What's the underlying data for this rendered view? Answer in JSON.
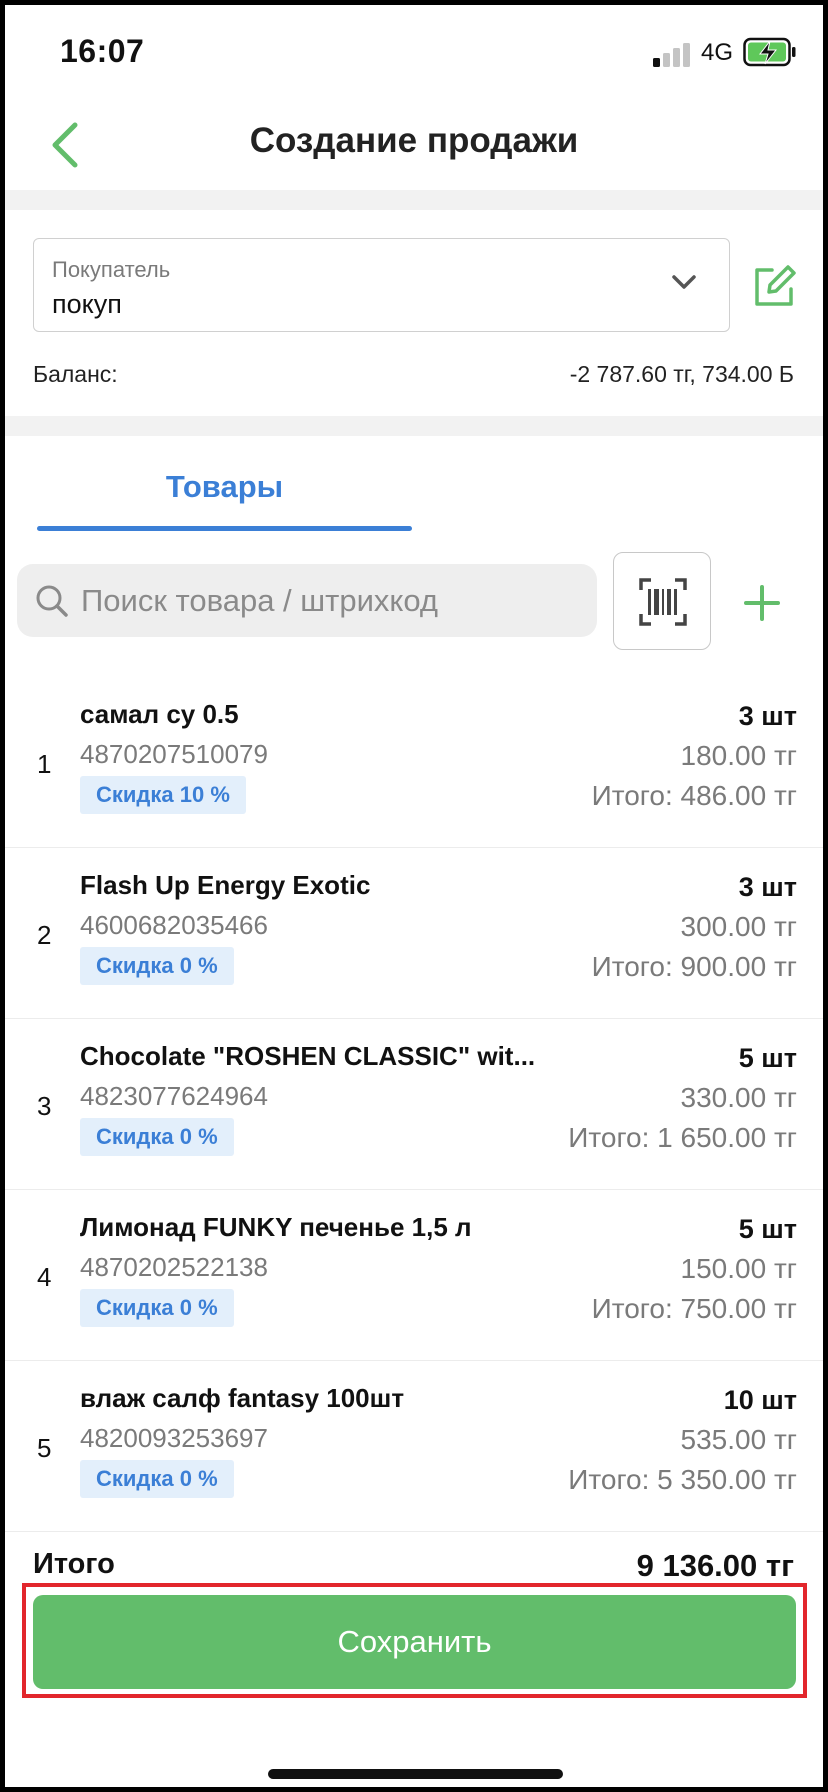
{
  "status_bar": {
    "time": "16:07",
    "network": "4G"
  },
  "nav": {
    "title": "Создание продажи"
  },
  "customer": {
    "label": "Покупатель",
    "value": "покуп"
  },
  "balance": {
    "label": "Баланс:",
    "value": "-2 787.60 тг, 734.00 Б"
  },
  "tabs": [
    {
      "label": "Товары",
      "active": true
    }
  ],
  "search": {
    "placeholder": "Поиск товара / штрихкод"
  },
  "items": [
    {
      "index": "1",
      "name": "самал су 0.5",
      "barcode": "4870207510079",
      "discount": "Скидка 10 %",
      "qty": "3 шт",
      "price": "180.00 тг",
      "total": "Итого: 486.00 тг"
    },
    {
      "index": "2",
      "name": "Flash Up Energy Exotic",
      "barcode": "4600682035466",
      "discount": "Скидка 0 %",
      "qty": "3 шт",
      "price": "300.00 тг",
      "total": "Итого: 900.00 тг"
    },
    {
      "index": "3",
      "name": "Chocolate \"ROSHEN CLASSIC\" wit...",
      "barcode": "4823077624964",
      "discount": "Скидка 0 %",
      "qty": "5 шт",
      "price": "330.00 тг",
      "total": "Итого: 1 650.00 тг"
    },
    {
      "index": "4",
      "name": "Лимонад FUNKY печенье 1,5 л",
      "barcode": "4870202522138",
      "discount": "Скидка 0 %",
      "qty": "5 шт",
      "price": "150.00 тг",
      "total": "Итого: 750.00 тг"
    },
    {
      "index": "5",
      "name": "влаж салф fantasy 100шт",
      "barcode": "4820093253697",
      "discount": "Скидка 0 %",
      "qty": "10 шт",
      "price": "535.00 тг",
      "total": "Итого: 5 350.00 тг"
    }
  ],
  "summary": {
    "label": "Итого",
    "value": "9 136.00 тг"
  },
  "actions": {
    "save_label": "Сохранить"
  },
  "colors": {
    "accent_green": "#62bd6b",
    "accent_blue": "#3b7fd6",
    "highlight_red": "#e2262c"
  }
}
